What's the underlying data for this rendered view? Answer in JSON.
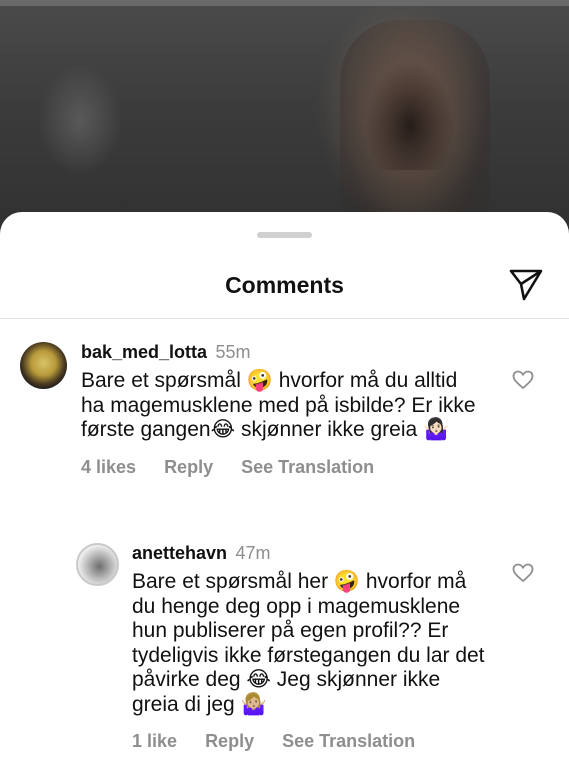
{
  "sheet": {
    "title": "Comments"
  },
  "comments": [
    {
      "username": "bak_med_lotta",
      "time": "55m",
      "text": "Bare et spørsmål 🤪 hvorfor må du alltid ha magemusklene med på isbilde? Er ikke første gangen😂 skjønner ikke greia 🤷🏻‍♀️",
      "likes": "4 likes",
      "reply": "Reply",
      "translate": "See Translation"
    },
    {
      "username": "anettehavn",
      "time": "47m",
      "text": "Bare et spørsmål her 🤪 hvorfor må du henge deg opp i magemusklene hun publiserer på egen profil?? Er tydeligvis ikke førstegangen du lar det påvirke deg 😂 Jeg skjønner ikke greia di jeg 🤷🏼‍♀️",
      "likes": "1 like",
      "reply": "Reply",
      "translate": "See Translation"
    }
  ],
  "icons": [
    "share-icon",
    "heart-icon"
  ],
  "colors": {
    "secondary_text": "#8e8e8e",
    "primary_text": "#111111",
    "sheet_bg": "#ffffff"
  }
}
